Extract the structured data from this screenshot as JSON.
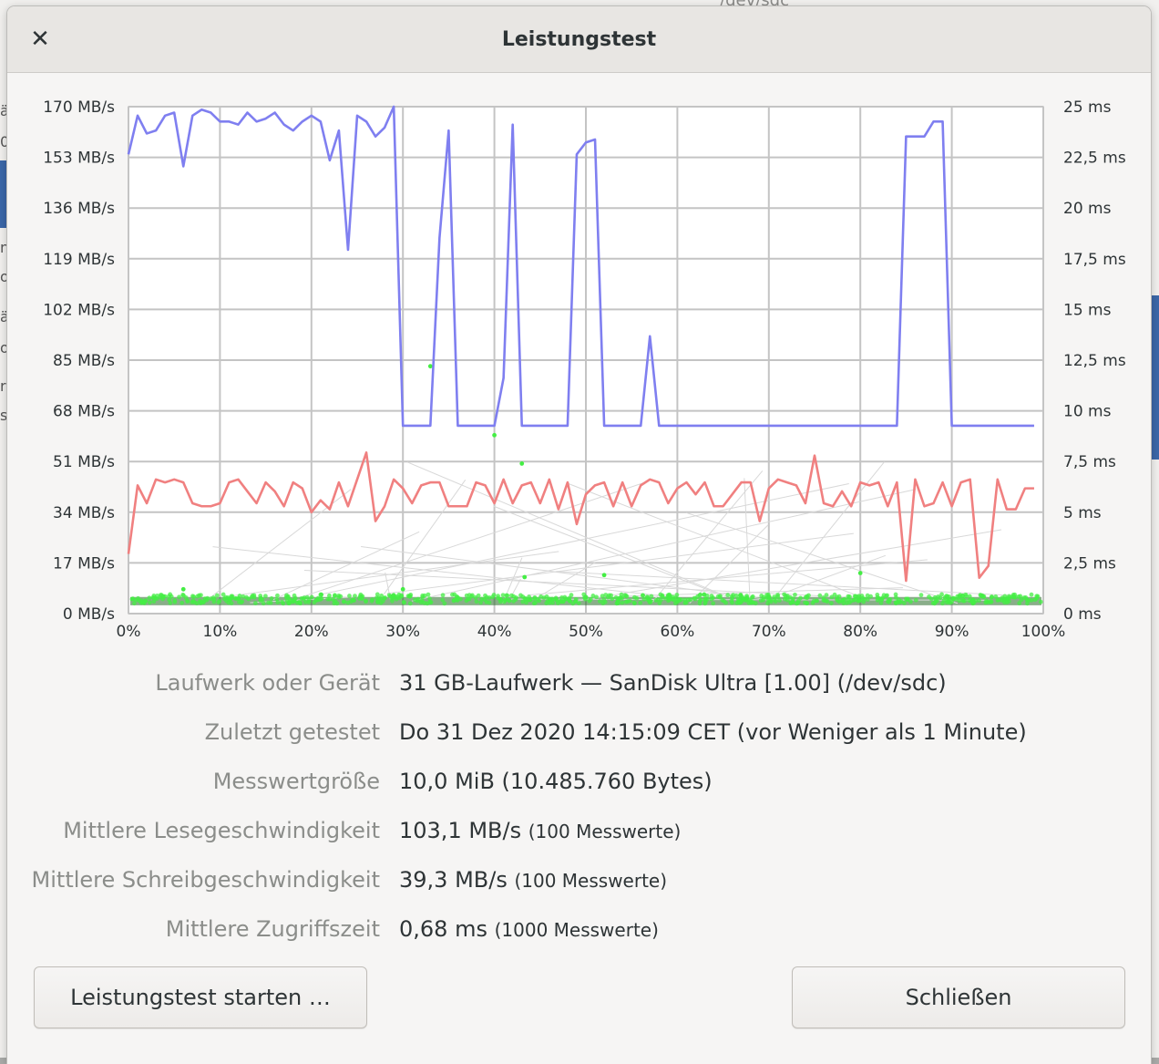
{
  "dialog": {
    "title": "Leistungstest",
    "close_icon": "close-icon",
    "start_button": "Leistungstest starten …",
    "close_button": "Schließen"
  },
  "background": {
    "path_text": "/dev/sdc",
    "letters": [
      "ä",
      "0",
      "nt",
      "os",
      "ä",
      "os",
      "r",
      "s"
    ]
  },
  "info": [
    {
      "label": "Laufwerk oder Gerät",
      "value": "31 GB-Laufwerk — SanDisk Ultra [1.00] (/dev/sdc)",
      "note": ""
    },
    {
      "label": "Zuletzt getestet",
      "value": "Do 31 Dez 2020 14:15:09 CET (vor Weniger als 1 Minute)",
      "note": ""
    },
    {
      "label": "Messwertgröße",
      "value": "10,0 MiB (10.485.760 Bytes)",
      "note": ""
    },
    {
      "label": "Mittlere Lesegeschwindigkeit",
      "value": "103,1 MB/s",
      "note": "(100 Messwerte)"
    },
    {
      "label": "Mittlere Schreibgeschwindigkeit",
      "value": "39,3 MB/s",
      "note": "(100 Messwerte)"
    },
    {
      "label": "Mittlere Zugriffszeit",
      "value": "0,68 ms",
      "note": "(1000 Messwerte)"
    }
  ],
  "chart_data": {
    "type": "line",
    "left_axis": {
      "ticks": [
        "0 MB/s",
        "17 MB/s",
        "34 MB/s",
        "51 MB/s",
        "68 MB/s",
        "85 MB/s",
        "102 MB/s",
        "119 MB/s",
        "136 MB/s",
        "153 MB/s",
        "170 MB/s"
      ],
      "ylim": [
        0,
        170
      ]
    },
    "right_axis": {
      "ticks": [
        "0 ms",
        "2,5 ms",
        "5 ms",
        "7,5 ms",
        "10 ms",
        "12,5 ms",
        "15 ms",
        "17,5 ms",
        "20 ms",
        "22,5 ms",
        "25 ms"
      ],
      "ylim": [
        0,
        25
      ]
    },
    "x_axis": {
      "ticks": [
        "0%",
        "10%",
        "20%",
        "30%",
        "40%",
        "50%",
        "60%",
        "70%",
        "80%",
        "90%",
        "100%"
      ],
      "xlim": [
        0,
        100
      ]
    },
    "grid": true,
    "colors": {
      "read": "#7f7ff0",
      "write": "#f08080",
      "access": "#44ee44",
      "access_dense": "#2a6b2a"
    },
    "series": [
      {
        "key": "read",
        "axis": "left",
        "x": [
          0,
          1,
          2,
          3,
          4,
          5,
          6,
          7,
          8,
          9,
          10,
          11,
          12,
          13,
          14,
          15,
          16,
          17,
          18,
          19,
          20,
          21,
          22,
          23,
          24,
          25,
          26,
          27,
          28,
          29,
          30,
          31,
          32,
          33,
          34,
          35,
          36,
          37,
          38,
          39,
          40,
          41,
          42,
          43,
          44,
          45,
          46,
          47,
          48,
          49,
          50,
          51,
          52,
          53,
          54,
          55,
          56,
          57,
          58,
          59,
          60,
          61,
          62,
          63,
          64,
          65,
          66,
          67,
          68,
          69,
          70,
          71,
          72,
          73,
          74,
          75,
          76,
          77,
          78,
          79,
          80,
          81,
          82,
          83,
          84,
          85,
          86,
          87,
          88,
          89,
          90,
          91,
          92,
          93,
          94,
          95,
          96,
          97,
          98,
          99
        ],
        "values": [
          154,
          167,
          161,
          162,
          167,
          168,
          150,
          167,
          169,
          168,
          165,
          165,
          164,
          168,
          165,
          166,
          168,
          164,
          162,
          165,
          167,
          165,
          152,
          162,
          122,
          167,
          165,
          160,
          163,
          170,
          63,
          63,
          63,
          63,
          126,
          162,
          63,
          63,
          63,
          63,
          63,
          79,
          164,
          63,
          63,
          63,
          63,
          63,
          63,
          154,
          158,
          159,
          63,
          63,
          63,
          63,
          63,
          93,
          63,
          63,
          63,
          63,
          63,
          63,
          63,
          63,
          63,
          63,
          63,
          63,
          63,
          63,
          63,
          63,
          63,
          63,
          63,
          63,
          63,
          63,
          63,
          63,
          63,
          63,
          63,
          160,
          160,
          160,
          165,
          165,
          63,
          63,
          63,
          63,
          63,
          63,
          63,
          63,
          63,
          63
        ]
      },
      {
        "key": "write",
        "axis": "left",
        "x": [
          0,
          1,
          2,
          3,
          4,
          5,
          6,
          7,
          8,
          9,
          10,
          11,
          12,
          13,
          14,
          15,
          16,
          17,
          18,
          19,
          20,
          21,
          22,
          23,
          24,
          25,
          26,
          27,
          28,
          29,
          30,
          31,
          32,
          33,
          34,
          35,
          36,
          37,
          38,
          39,
          40,
          41,
          42,
          43,
          44,
          45,
          46,
          47,
          48,
          49,
          50,
          51,
          52,
          53,
          54,
          55,
          56,
          57,
          58,
          59,
          60,
          61,
          62,
          63,
          64,
          65,
          66,
          67,
          68,
          69,
          70,
          71,
          72,
          73,
          74,
          75,
          76,
          77,
          78,
          79,
          80,
          81,
          82,
          83,
          84,
          85,
          86,
          87,
          88,
          89,
          90,
          91,
          92,
          93,
          94,
          95,
          96,
          97,
          98,
          99
        ],
        "values": [
          20,
          43,
          37,
          45,
          44,
          45,
          44,
          37,
          36,
          36,
          37,
          44,
          45,
          41,
          37,
          44,
          41,
          36,
          44,
          42,
          34,
          38,
          35,
          44,
          36,
          45,
          54,
          31,
          36,
          45,
          42,
          37,
          43,
          44,
          44,
          36,
          36,
          36,
          44,
          43,
          37,
          45,
          37,
          43,
          44,
          37,
          45,
          35,
          44,
          30,
          40,
          43,
          44,
          36,
          44,
          36,
          43,
          45,
          44,
          37,
          42,
          44,
          40,
          44,
          36,
          36,
          40,
          44,
          44,
          31,
          42,
          45,
          44,
          43,
          37,
          53,
          37,
          36,
          41,
          36,
          44,
          43,
          44,
          36,
          44,
          11,
          45,
          36,
          37,
          44,
          36,
          44,
          45,
          12,
          16,
          45,
          35,
          35,
          42,
          42
        ]
      }
    ],
    "access_scatter": {
      "description_value_band_ms": [
        0.5,
        1.0
      ]
    }
  }
}
